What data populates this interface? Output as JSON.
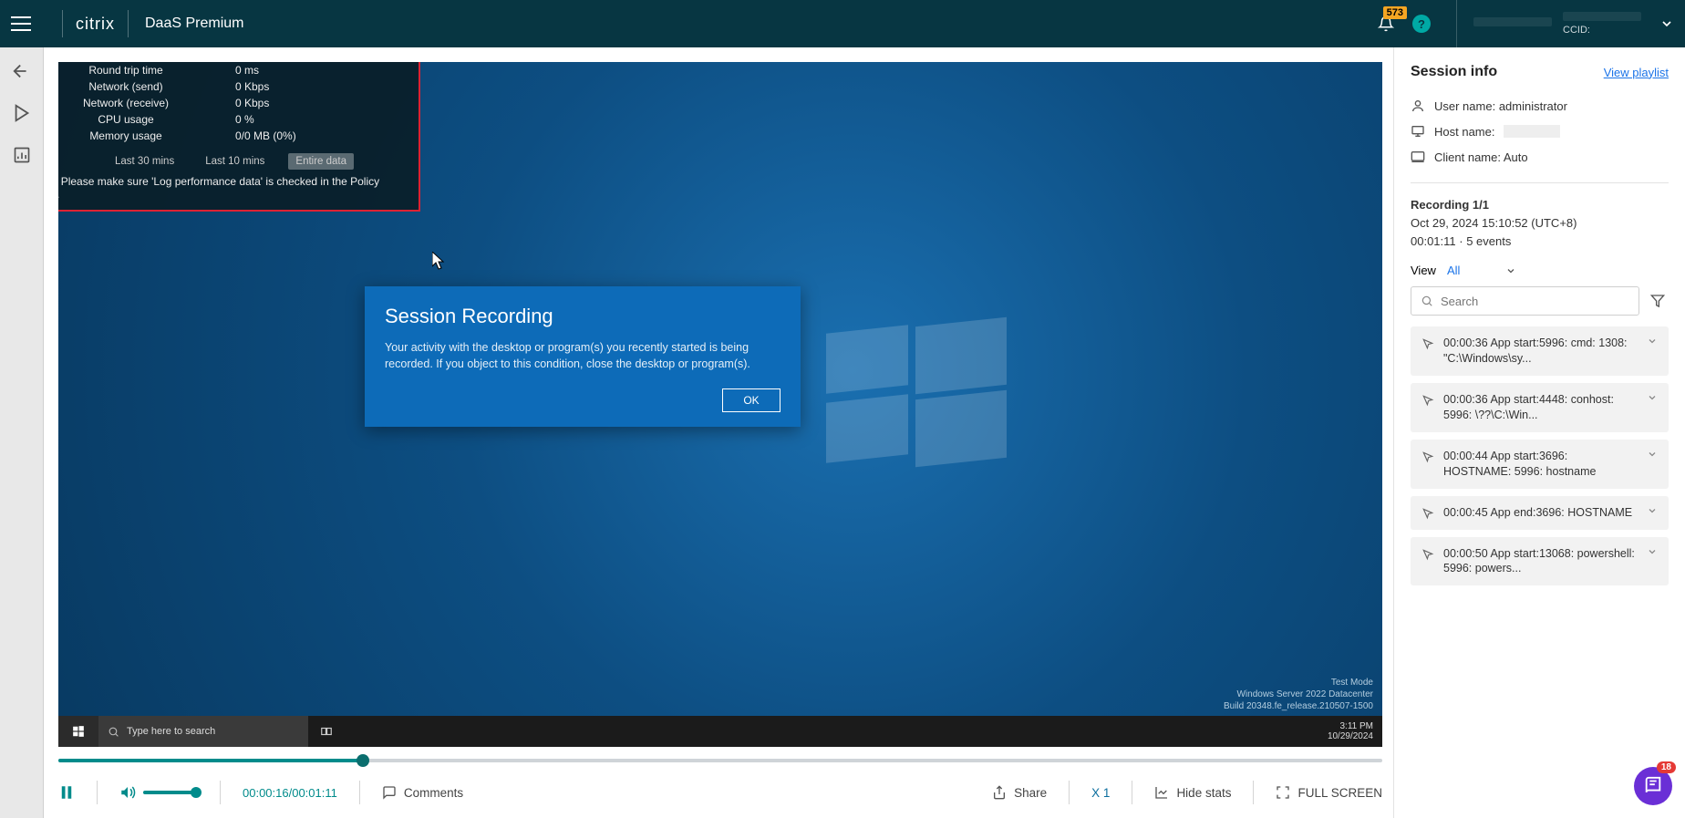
{
  "header": {
    "brand": "citrix",
    "product": "DaaS Premium",
    "notification_count": "573",
    "ccid_label": "CCID:"
  },
  "stats": {
    "rows": [
      {
        "label": "Round trip time",
        "value": "0 ms"
      },
      {
        "label": "Network (send)",
        "value": "0 Kbps"
      },
      {
        "label": "Network (receive)",
        "value": "0 Kbps"
      },
      {
        "label": "CPU usage",
        "value": "0 %"
      },
      {
        "label": "Memory usage",
        "value": "0/0 MB (0%)"
      }
    ],
    "tabs": {
      "last30": "Last 30 mins",
      "last10": "Last 10 mins",
      "entire": "Entire data"
    },
    "message": "No data. Please make sure 'Log performance data' is checked in the Policy Console."
  },
  "dialog": {
    "title": "Session Recording",
    "body": "Your activity with the desktop or program(s) you recently started is being recorded. If you object to this condition, close the desktop or program(s).",
    "ok": "OK"
  },
  "watermark": {
    "l1": "Test Mode",
    "l2": "Windows Server 2022 Datacenter",
    "l3": "Build 20348.fe_release.210507-1500"
  },
  "taskbar": {
    "search_placeholder": "Type here to search",
    "time": "3:11 PM",
    "date": "10/29/2024"
  },
  "controls": {
    "time": "00:00:16/00:01:11",
    "comments": "Comments",
    "share": "Share",
    "speed": "X 1",
    "hide_stats": "Hide stats",
    "fullscreen": "FULL SCREEN"
  },
  "side": {
    "title": "Session info",
    "view_playlist": "View playlist",
    "username_label": "User name: ",
    "username": "administrator",
    "hostname_label": "Host name: ",
    "clientname_label": "Client name: ",
    "clientname": "Auto",
    "recording_label": "Recording 1/1",
    "timestamp": "Oct 29, 2024 15:10:52 (UTC+8)",
    "duration_events": "00:01:11 · 5 events",
    "view_label": "View",
    "view_value": "All",
    "search_placeholder": "Search",
    "events": [
      "00:00:36 App start:5996: cmd: 1308: \"C:\\Windows\\sy...",
      "00:00:36 App start:4448: conhost: 5996: \\??\\C:\\Win...",
      "00:00:44 App start:3696: HOSTNAME: 5996: hostname",
      "00:00:45 App end:3696: HOSTNAME",
      "00:00:50 App start:13068: powershell: 5996: powers..."
    ]
  },
  "float_badge": "18"
}
